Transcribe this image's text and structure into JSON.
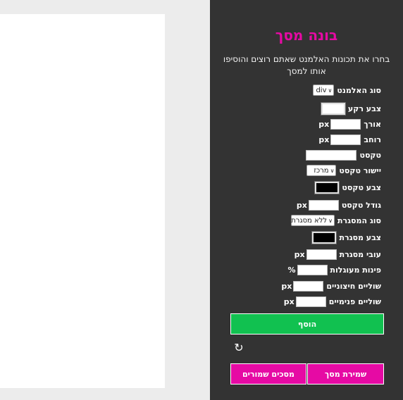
{
  "panel": {
    "title": "בונה מסך",
    "description": "בחרו את תכונות האלמנט שאתם רוצים והוסיפו אותו למסך"
  },
  "form": {
    "element_type": {
      "label": "סוג האלמנט",
      "value": "div"
    },
    "bg_color": {
      "label": "צבע רקע",
      "value": "#ffffff"
    },
    "height": {
      "label": "אורך",
      "unit": "px"
    },
    "width": {
      "label": "רוחב",
      "unit": "px"
    },
    "text": {
      "label": "טקסט"
    },
    "text_align": {
      "label": "יישור טקסט",
      "value": "מרכז"
    },
    "text_color": {
      "label": "צבע טקסט",
      "value": "#000000"
    },
    "font_size": {
      "label": "גודל טקסט",
      "unit": "px"
    },
    "border_type": {
      "label": "סוג המסגרת",
      "value": "ללא מסגרת"
    },
    "border_color": {
      "label": "צבע מסגרת",
      "value": "#000000"
    },
    "border_width": {
      "label": "עובי מסגרת",
      "unit": "px"
    },
    "border_radius": {
      "label": "פינות מעוגלות",
      "unit": "%"
    },
    "margin": {
      "label": "שוליים חיצוניים",
      "unit": "px"
    },
    "padding": {
      "label": "שוליים פנימיים",
      "unit": "px"
    }
  },
  "buttons": {
    "add": "הוסף",
    "save_screen": "שמירת מסך",
    "saved_screens": "מסכים שמורים"
  },
  "icons": {
    "refresh": "refresh-icon"
  },
  "colors": {
    "accent": "#e60aa4",
    "add": "#11c150",
    "panel": "#333333"
  }
}
